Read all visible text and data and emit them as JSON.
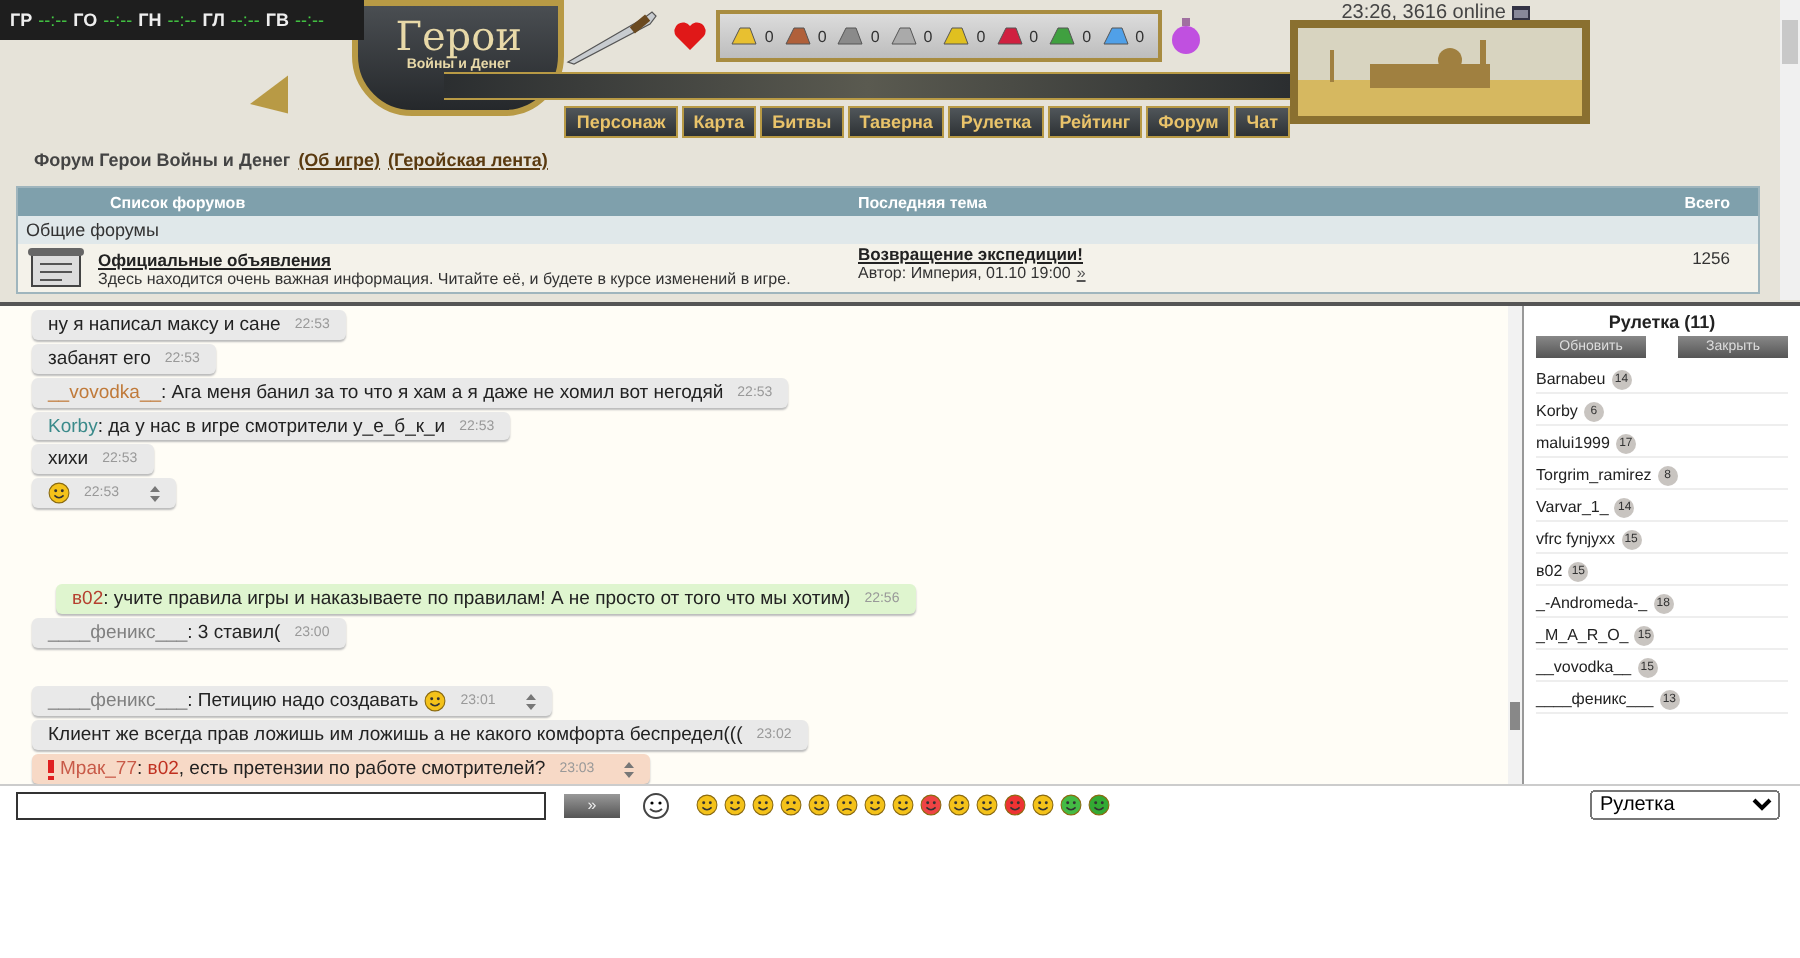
{
  "timers": [
    {
      "label": "ГР",
      "value": "--:--"
    },
    {
      "label": "ГО",
      "value": "--:--"
    },
    {
      "label": "ГН",
      "value": "--:--"
    },
    {
      "label": "ГЛ",
      "value": "--:--"
    },
    {
      "label": "ГВ",
      "value": "--:--"
    }
  ],
  "logo": {
    "title": "Герои",
    "subtitle": "Войны и Денег"
  },
  "resources": [
    {
      "kind": "gold",
      "count": "0"
    },
    {
      "kind": "wood",
      "count": "0"
    },
    {
      "kind": "ore",
      "count": "0"
    },
    {
      "kind": "mercury",
      "count": "0"
    },
    {
      "kind": "sulfur",
      "count": "0"
    },
    {
      "kind": "crystal",
      "count": "0"
    },
    {
      "kind": "gems",
      "count": "0"
    },
    {
      "kind": "diamond",
      "count": "0"
    }
  ],
  "nav": [
    "Персонаж",
    "Карта",
    "Битвы",
    "Таверна",
    "Рулетка",
    "Рейтинг",
    "Форум",
    "Чат"
  ],
  "status": "23:26, 3616 online",
  "breadcrumb": {
    "title": "Форум Герои Войны и Денег",
    "links": [
      "(Об игре)",
      "(Геройская лента)"
    ]
  },
  "forum_table": {
    "columns": [
      "Список форумов",
      "Последняя тема",
      "Всего"
    ],
    "section": "Общие форумы",
    "rows": [
      {
        "title": "Официальные объявления",
        "description": "Здесь находится очень важная информация. Читайте её, и будете в курсе изменений в игре.",
        "last_topic": "Возвращение экспедиции!",
        "last_author": "Автор: Империя, 01.10 19:00",
        "more": "»",
        "total": "1256"
      }
    ]
  },
  "messages": [
    {
      "kind": "normal",
      "text": "ну я написал максу и сане",
      "time": "22:53",
      "spinner": false
    },
    {
      "kind": "normal",
      "text": "забанят его",
      "time": "22:53",
      "spinner": false
    },
    {
      "kind": "normal",
      "nick": "__vovodka__",
      "color": "#c07a3a",
      "text": ": Ага меня банил за то что я хам а я даже не хомил вот негодяй",
      "time": "22:53",
      "spinner": false
    },
    {
      "kind": "normal",
      "nick": "Korby",
      "color": "#3a8a8a",
      "text": ": да у нас в игре смотрители у_е_б_к_и",
      "time": "22:53",
      "spinner": false
    },
    {
      "kind": "normal",
      "text": "хихи",
      "time": "22:53",
      "spinner": false
    },
    {
      "kind": "normal",
      "smiley": true,
      "time": "22:53",
      "spinner": true
    },
    {
      "kind": "gap"
    },
    {
      "kind": "gap"
    },
    {
      "kind": "highlight",
      "nick": "в02",
      "color": "#b5402f",
      "text": ": учите правила игры и наказываете по правилам! А не просто от того что мы хотим)",
      "time": "22:56",
      "spinner": false
    },
    {
      "kind": "normal",
      "nick": "____феникс___",
      "color": "#808080",
      "text": ": 3 ставил(",
      "time": "23:00",
      "spinner": false
    },
    {
      "kind": "gap"
    },
    {
      "kind": "normal",
      "nick": "____феникс___",
      "color": "#808080",
      "text": ": Петицию надо создавать",
      "smiley": true,
      "time": "23:01",
      "spinner": true
    },
    {
      "kind": "normal",
      "text": "Клиент же всегда прав ложишь им ложишь а не какого комфорта беспредел(((",
      "time": "23:02",
      "spinner": false
    },
    {
      "kind": "private",
      "nick": "Мрак_77",
      "color": "#c85a48",
      "separator": ": ",
      "mention": "в02",
      "text": ", есть претензии по работе смотрителей?",
      "time": "23:03",
      "spinner": true
    }
  ],
  "users": {
    "title": "Рулетка (11)",
    "buttons": [
      "Обновить",
      "Закрыть"
    ],
    "list": [
      {
        "name": "Barnabeu",
        "level": "14"
      },
      {
        "name": "Korby",
        "level": "6"
      },
      {
        "name": "malui1999",
        "level": "17"
      },
      {
        "name": "Torgrim_ramirez",
        "level": "8"
      },
      {
        "name": "Varvar_1_",
        "level": "14"
      },
      {
        "name": "vfrc fynjyxx",
        "level": "15"
      },
      {
        "name": "в02",
        "level": "15"
      },
      {
        "name": "_-Andromeda-_",
        "level": "18"
      },
      {
        "name": "_M_A_R_O_",
        "level": "15"
      },
      {
        "name": "__vovodka__",
        "level": "15"
      },
      {
        "name": "____феникс___",
        "level": "13"
      }
    ]
  },
  "input": {
    "send": "»",
    "smileys": [
      {
        "kind": "smile"
      },
      {
        "kind": "grin"
      },
      {
        "kind": "wink"
      },
      {
        "kind": "sad"
      },
      {
        "kind": "laugh"
      },
      {
        "kind": "cry"
      },
      {
        "kind": "cool"
      },
      {
        "kind": "tongue"
      },
      {
        "kind": "angry"
      },
      {
        "kind": "shock"
      },
      {
        "kind": "pray"
      },
      {
        "kind": "devil"
      },
      {
        "kind": "nerd"
      },
      {
        "kind": "green"
      },
      {
        "kind": "dollar"
      }
    ]
  },
  "channel": "Рулетка"
}
